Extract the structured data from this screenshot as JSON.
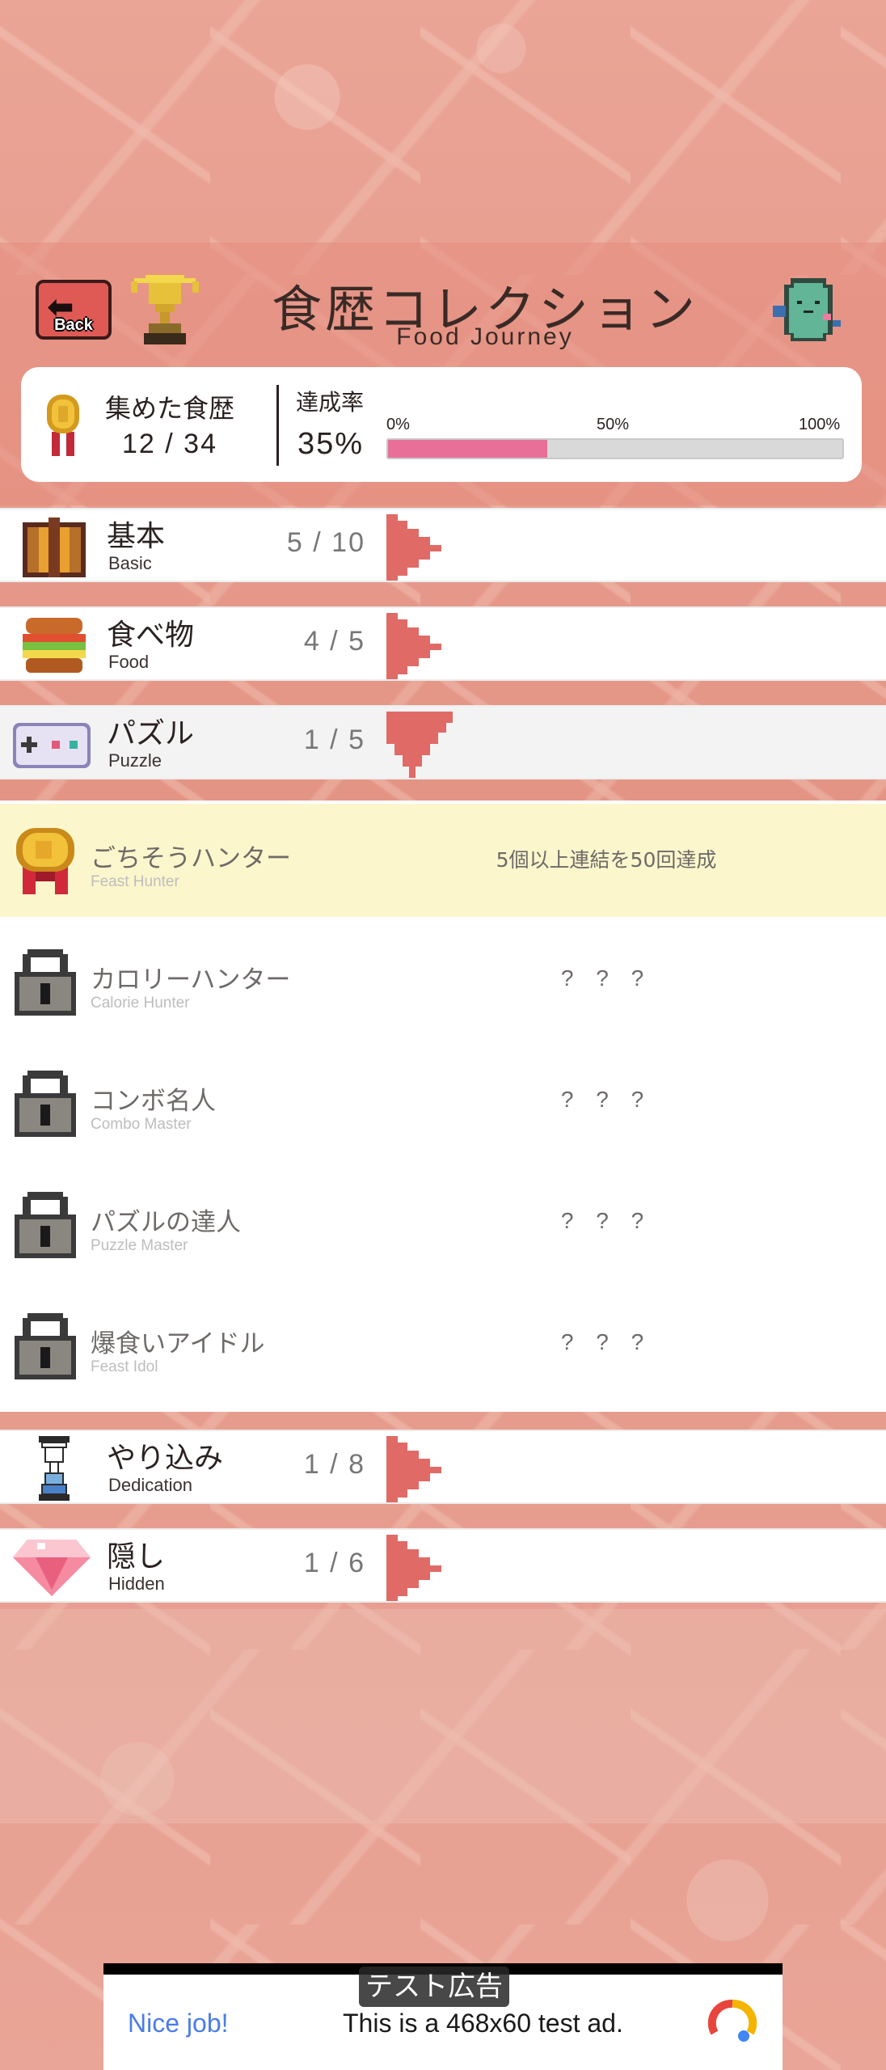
{
  "header": {
    "back_label": "Back",
    "title": "食歴コレクション",
    "subtitle": "Food Journey"
  },
  "summary": {
    "collected_label": "集めた食歴",
    "collected_count": "12 / 34",
    "rate_label": "達成率",
    "rate_value": "35%",
    "rate_fraction": 0.35,
    "ticks": [
      "0%",
      "50%",
      "100%"
    ]
  },
  "categories": [
    {
      "name": "基本",
      "en": "Basic",
      "count": "5 / 10",
      "icon": "gift-box-icon",
      "expanded": false
    },
    {
      "name": "食べ物",
      "en": "Food",
      "count": "4 / 5",
      "icon": "burger-icon",
      "expanded": false
    },
    {
      "name": "パズル",
      "en": "Puzzle",
      "count": "1 / 5",
      "icon": "gamepad-icon",
      "expanded": true
    },
    {
      "name": "やり込み",
      "en": "Dedication",
      "count": "1 / 8",
      "icon": "hourglass-icon",
      "expanded": false
    },
    {
      "name": "隠し",
      "en": "Hidden",
      "count": "1 / 6",
      "icon": "gem-icon",
      "expanded": false
    }
  ],
  "achievements": [
    {
      "name": "ごちそうハンター",
      "en": "Feast Hunter",
      "desc": "5個以上連結を50回達成",
      "unlocked": true
    },
    {
      "name": "カロリーハンター",
      "en": "Calorie Hunter",
      "desc": "? ? ?",
      "unlocked": false
    },
    {
      "name": "コンボ名人",
      "en": "Combo Master",
      "desc": "? ? ?",
      "unlocked": false
    },
    {
      "name": "パズルの達人",
      "en": "Puzzle Master",
      "desc": "? ? ?",
      "unlocked": false
    },
    {
      "name": "爆食いアイドル",
      "en": "Feast Idol",
      "desc": "? ? ?",
      "unlocked": false
    }
  ],
  "ad": {
    "tag": "テスト広告",
    "nice": "Nice job!",
    "text": "This is a 468x60 test ad."
  },
  "colors": {
    "accent_pink": "#e87098",
    "arrow_red": "#e06a66",
    "unlocked_bg": "#fcf6cc"
  }
}
